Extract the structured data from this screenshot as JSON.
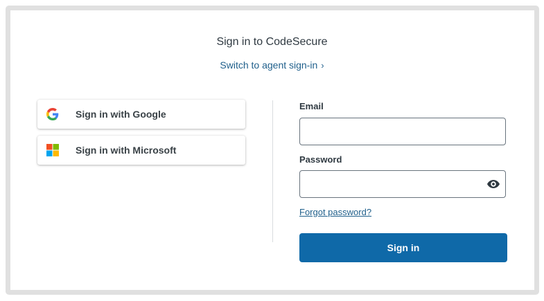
{
  "header": {
    "title": "Sign in to CodeSecure",
    "agent_link": "Switch to agent sign-in"
  },
  "sso": {
    "google_label": "Sign in with Google",
    "microsoft_label": "Sign in with Microsoft"
  },
  "form": {
    "email_label": "Email",
    "email_value": "",
    "password_label": "Password",
    "password_value": "",
    "forgot_label": "Forgot password?",
    "submit_label": "Sign in"
  },
  "icons": {
    "google": "google-logo-icon",
    "microsoft": "microsoft-logo-icon",
    "agent_chevron": "chevron-right-icon",
    "show_password": "eye-icon"
  },
  "colors": {
    "accent": "#0f69a8",
    "link": "#1f5f8b",
    "text": "#2f3941"
  }
}
